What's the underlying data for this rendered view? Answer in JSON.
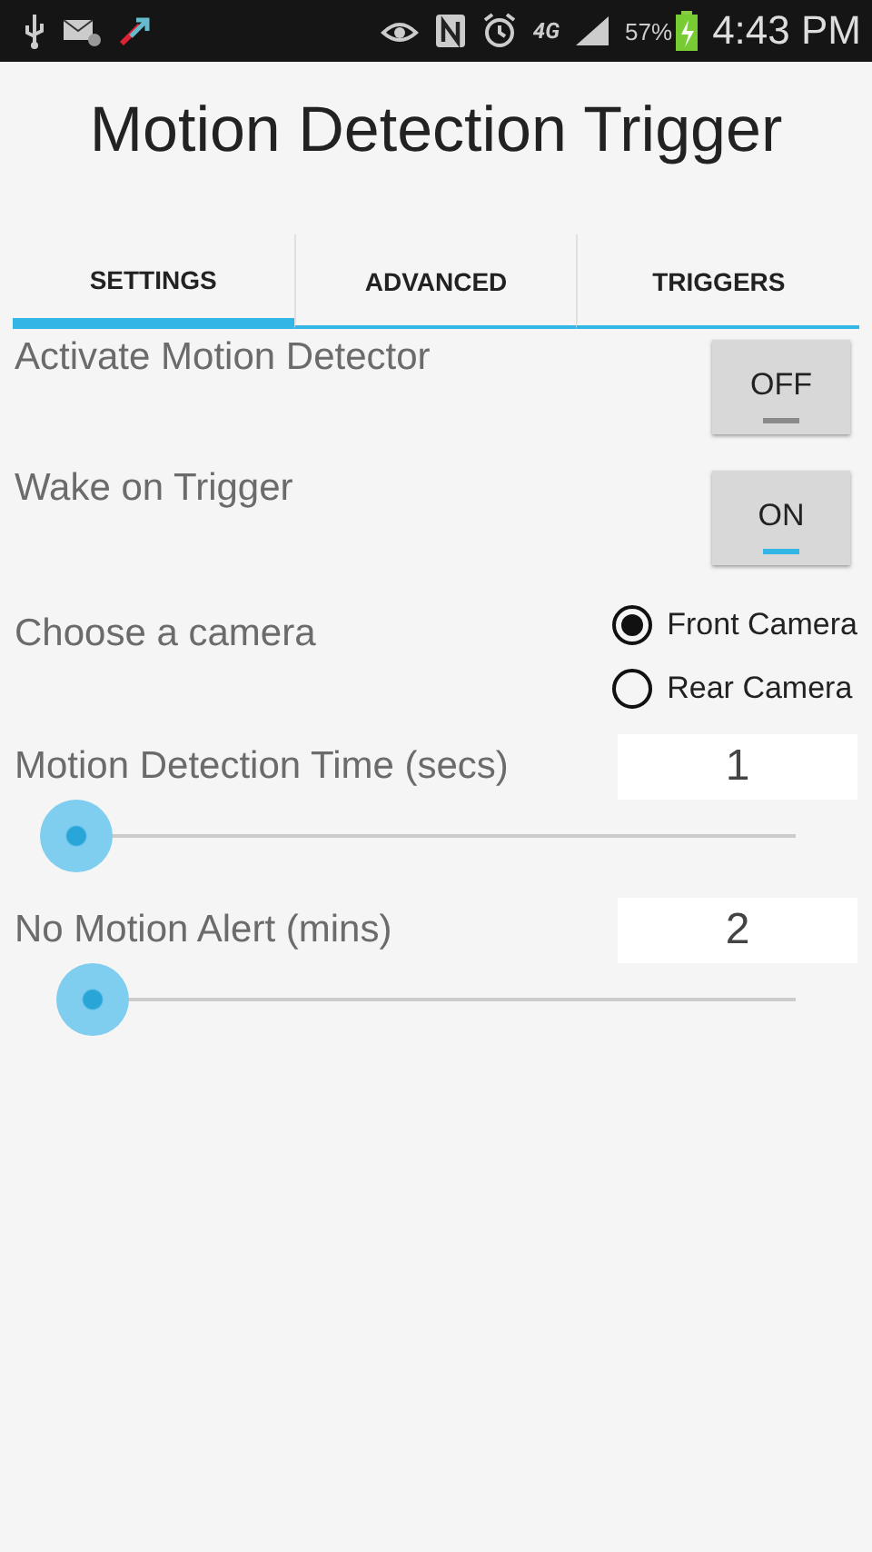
{
  "status_bar": {
    "network": "4G",
    "battery": "57%",
    "time": "4:43 PM"
  },
  "title": "Motion Detection Trigger",
  "tabs": [
    {
      "label": "SETTINGS",
      "selected": true
    },
    {
      "label": "ADVANCED",
      "selected": false
    },
    {
      "label": "TRIGGERS",
      "selected": false
    }
  ],
  "toggles": [
    {
      "label": "Activate Motion Detector",
      "text": "OFF",
      "on": false
    },
    {
      "label": "Wake on Trigger",
      "text": "ON",
      "on": true
    }
  ],
  "camera": {
    "label": "Choose a camera",
    "options": [
      {
        "label": "Front Camera",
        "selected": true
      },
      {
        "label": "Rear Camera",
        "selected": false
      }
    ]
  },
  "sliders": [
    {
      "label": "Motion Detection Time (secs)",
      "value": "1",
      "level": 0
    },
    {
      "label": "No Motion Alert (mins)",
      "value": "2",
      "level": 0.02
    }
  ]
}
